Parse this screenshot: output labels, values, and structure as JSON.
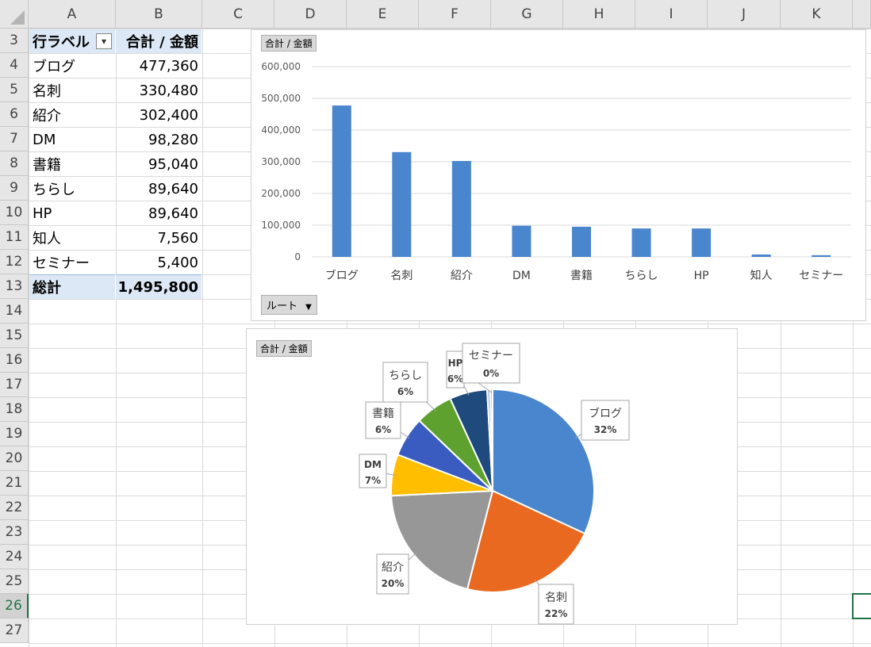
{
  "columns": [
    "A",
    "B",
    "C",
    "D",
    "E",
    "F",
    "G",
    "H",
    "I",
    "J",
    "K"
  ],
  "rows": [
    "3",
    "4",
    "5",
    "6",
    "7",
    "8",
    "9",
    "10",
    "11",
    "12",
    "13",
    "14",
    "15",
    "16",
    "17",
    "18",
    "19",
    "20",
    "21",
    "22",
    "23",
    "24",
    "25",
    "26",
    "27"
  ],
  "active_row": "26",
  "pivot": {
    "header_label": "行ラベル",
    "header_value": "合計 / 金額",
    "filter_icon": "filter-sort-icon",
    "items": [
      {
        "label": "ブログ",
        "value": "477,360"
      },
      {
        "label": "名刺",
        "value": "330,480"
      },
      {
        "label": "紹介",
        "value": "302,400"
      },
      {
        "label": "DM",
        "value": "98,280"
      },
      {
        "label": "書籍",
        "value": "95,040"
      },
      {
        "label": "ちらし",
        "value": "89,640"
      },
      {
        "label": "HP",
        "value": "89,640"
      },
      {
        "label": "知人",
        "value": "7,560"
      },
      {
        "label": "セミナー",
        "value": "5,400"
      }
    ],
    "total_label": "総計",
    "total_value": "1,495,800"
  },
  "bar_chart": {
    "value_tag": "合計 / 金額",
    "axis_button": "ルート",
    "axis_button_icon": "dropdown-triangle-icon",
    "bar_color": "#4a86cd"
  },
  "pie_chart": {
    "value_tag": "合計 / 金額"
  },
  "chart_data": [
    {
      "type": "bar",
      "categories": [
        "ブログ",
        "名刺",
        "紹介",
        "DM",
        "書籍",
        "ちらし",
        "HP",
        "知人",
        "セミナー"
      ],
      "values": [
        477360,
        330480,
        302400,
        98280,
        95040,
        89640,
        89640,
        7560,
        5400
      ],
      "ylim": [
        0,
        600000
      ],
      "yticks": [
        "0",
        "100,000",
        "200,000",
        "300,000",
        "400,000",
        "500,000",
        "600,000"
      ],
      "grid": true,
      "legend": "none"
    },
    {
      "type": "pie",
      "categories": [
        "ブログ",
        "名刺",
        "紹介",
        "DM",
        "書籍",
        "ちらし",
        "HP",
        "知人",
        "セミナー"
      ],
      "values": [
        477360,
        330480,
        302400,
        98280,
        95040,
        89640,
        89640,
        7560,
        5400
      ],
      "labels": [
        "32%",
        "22%",
        "20%",
        "7%",
        "6%",
        "6%",
        "6%",
        "",
        ""
      ],
      "label_names": [
        "ブログ",
        "名刺",
        "紹介",
        "DM",
        "書籍",
        "ちらし",
        "HP",
        "",
        ""
      ],
      "extra_label": {
        "name": "セミナー",
        "pct": "0%"
      },
      "colors": [
        "#4a86cd",
        "#e8691f",
        "#979797",
        "#ffbf00",
        "#3a5bc0",
        "#5ea12e",
        "#1f4a7d",
        "#a9bfe0",
        "#f0a070"
      ]
    }
  ]
}
